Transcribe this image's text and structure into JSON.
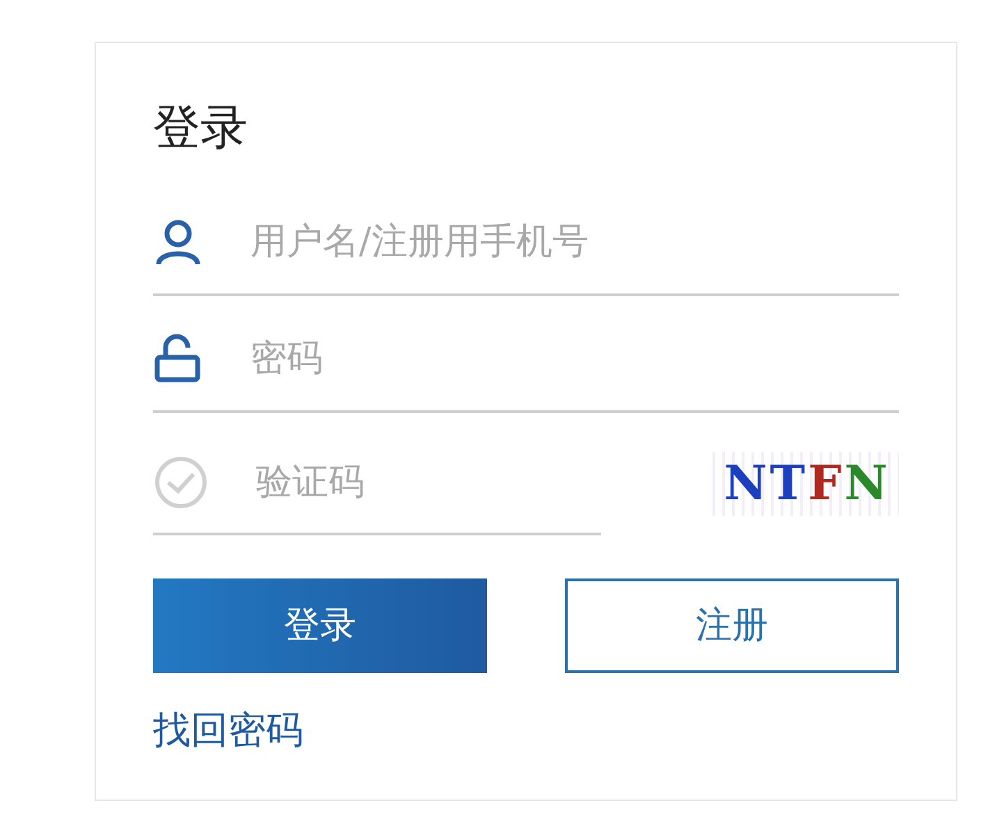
{
  "title": "登录",
  "fields": [
    {
      "kind": "user",
      "placeholder": "用户名/注册用手机号"
    },
    {
      "kind": "lock",
      "placeholder": "密码"
    },
    {
      "kind": "check",
      "placeholder": "验证码"
    }
  ],
  "captcha": [
    {
      "char": "N",
      "color": "#1c3fbf"
    },
    {
      "char": "T",
      "color": "#1c3fbf"
    },
    {
      "char": "F",
      "color": "#b0281e"
    },
    {
      "char": "N",
      "color": "#2a8a2a"
    }
  ],
  "buttons": [
    {
      "kind": "primary",
      "label": "登录"
    },
    {
      "kind": "outline",
      "label": "注册"
    }
  ],
  "link": "找回密码"
}
